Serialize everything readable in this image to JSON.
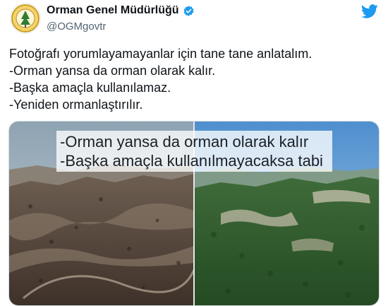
{
  "header": {
    "display_name": "Orman Genel Müdürlüğü",
    "handle": "@OGMgovtr"
  },
  "tweet": {
    "lines": [
      "Fotoğrafı yorumlayamayanlar için tane tane anlatalım.",
      "-Orman yansa da orman olarak kalır.",
      "-Başka amaçla kullanılamaz.",
      "-Yeniden ormanlaştırılır."
    ]
  },
  "media": {
    "overlay_lines": [
      "-Orman yansa da orman olarak kalır",
      "-Başka amaçla kullanılmayacaksa tabi"
    ]
  },
  "colors": {
    "brand": "#1d9bf0",
    "text": "#0f1419",
    "muted": "#536471"
  },
  "icons": [
    "org-logo-icon",
    "verified-badge-icon",
    "twitter-bird-icon"
  ]
}
